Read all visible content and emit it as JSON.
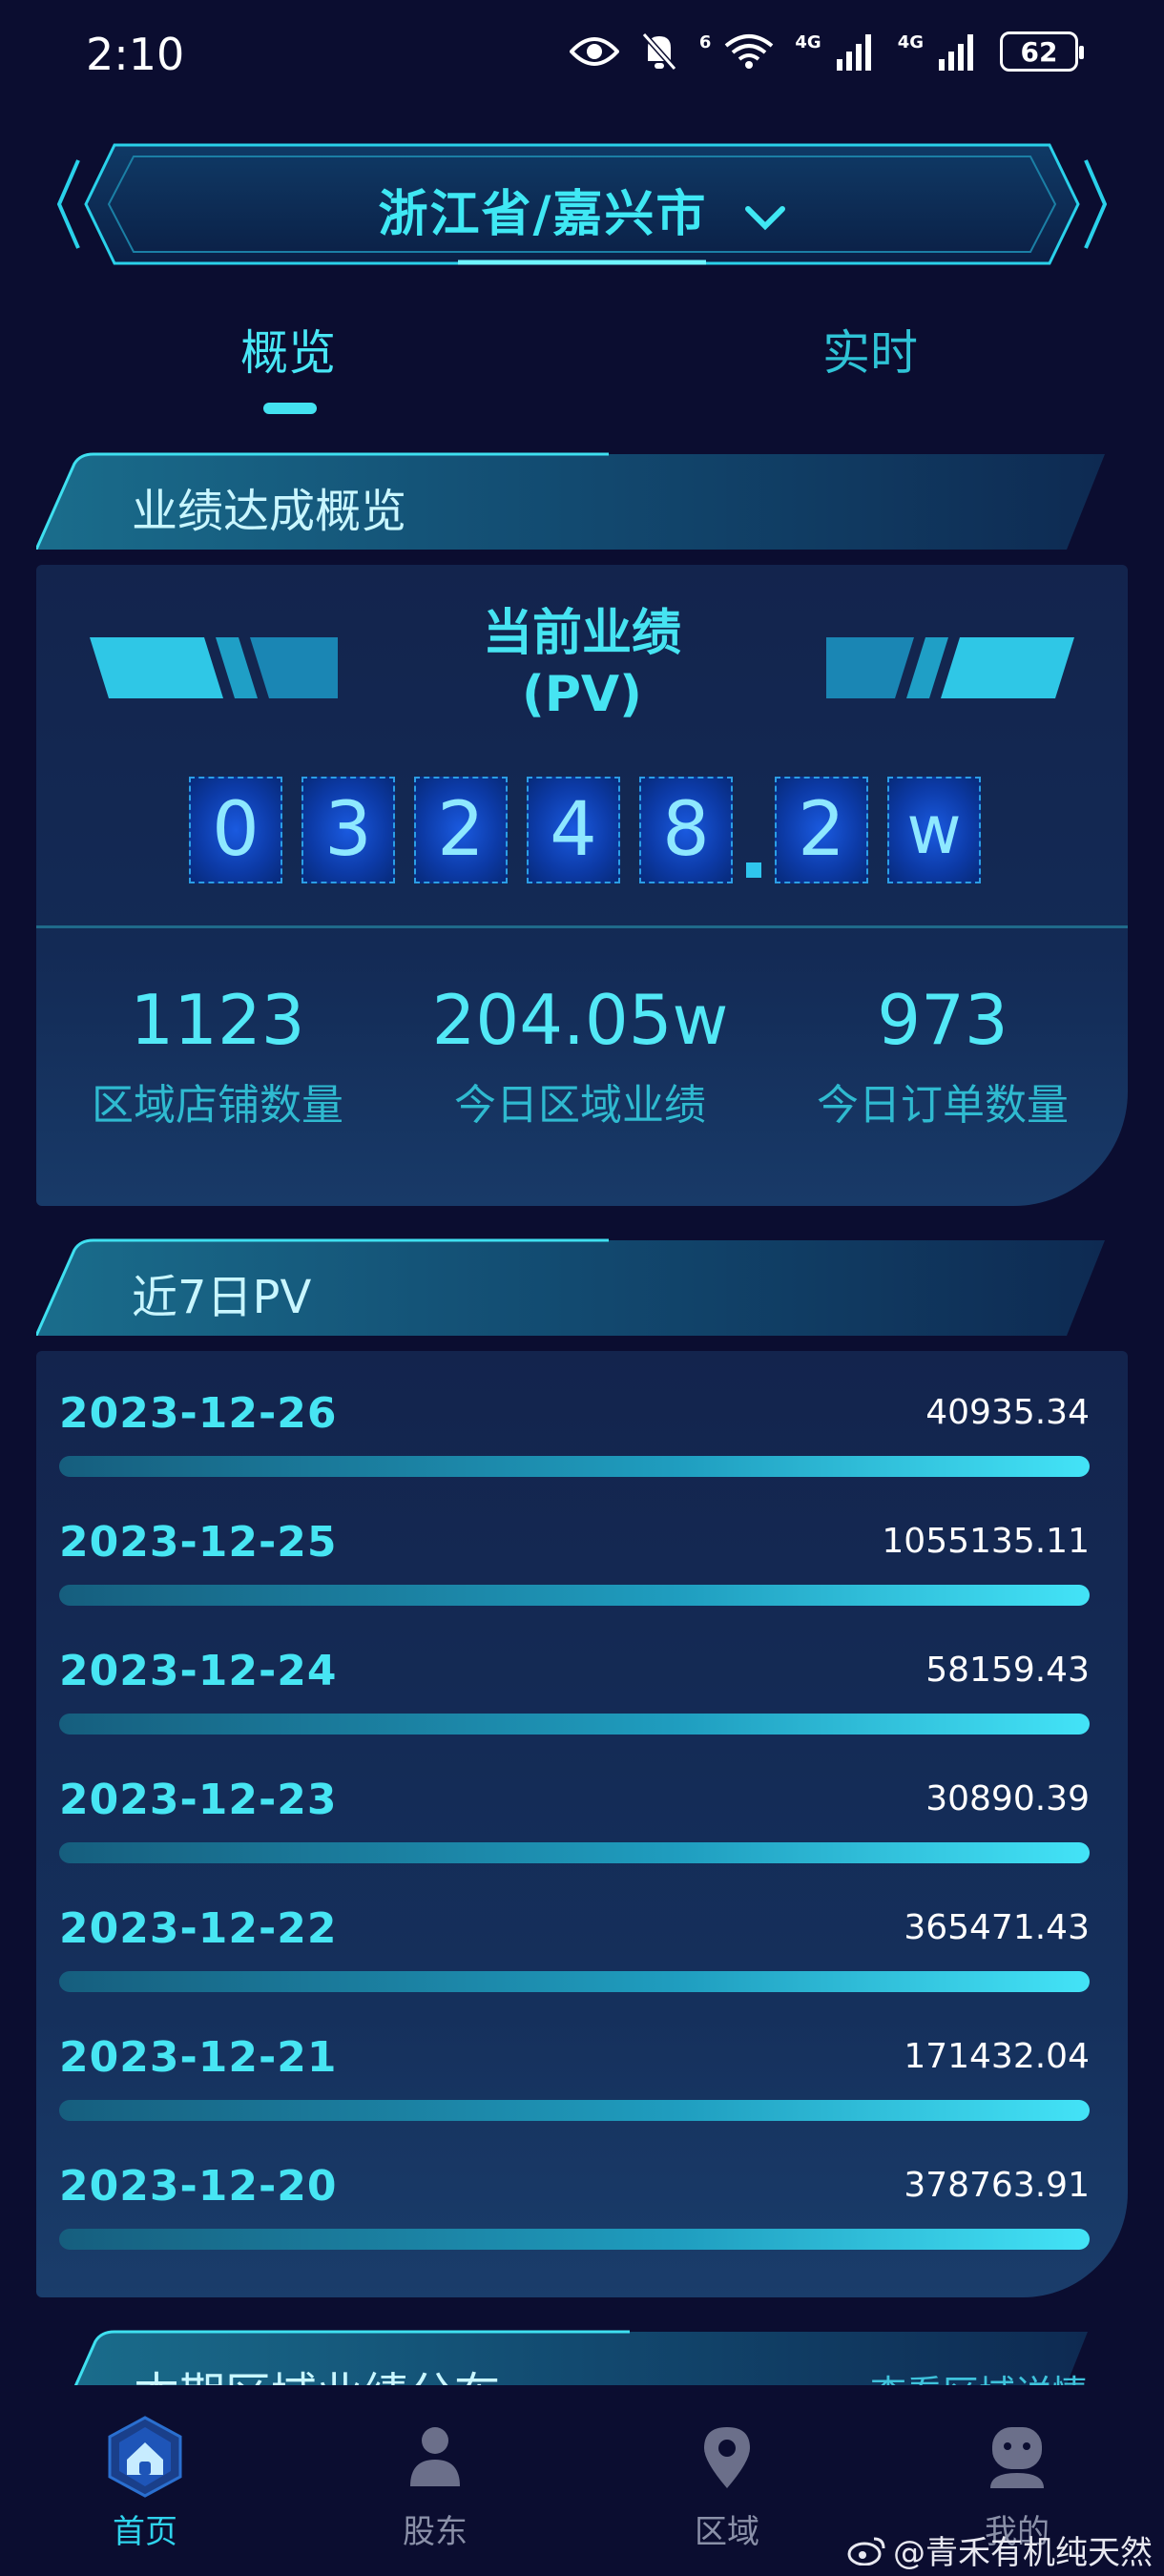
{
  "status_bar": {
    "time": "2:10",
    "wifi_label": "6",
    "sim1_label": "4G",
    "sim2_label": "4G",
    "battery": "62"
  },
  "region": {
    "label": "浙江省/嘉兴市"
  },
  "tabs": [
    {
      "label": "概览",
      "active": true
    },
    {
      "label": "实时",
      "active": false
    }
  ],
  "performance": {
    "section_title": "业绩达成概览",
    "card_title_line1": "当前业绩",
    "card_title_line2": "(PV)",
    "digits": [
      "0",
      "3",
      "2",
      "4",
      "8"
    ],
    "decimal_digit": "2",
    "unit": "w",
    "stats": [
      {
        "value": "1123",
        "label": "区域店铺数量"
      },
      {
        "value": "204.05w",
        "label": "今日区域业绩"
      },
      {
        "value": "973",
        "label": "今日订单数量"
      }
    ]
  },
  "pv7": {
    "section_title": "近7日PV",
    "rows": [
      {
        "date": "2023-12-26",
        "value": "40935.34"
      },
      {
        "date": "2023-12-25",
        "value": "1055135.11"
      },
      {
        "date": "2023-12-24",
        "value": "58159.43"
      },
      {
        "date": "2023-12-23",
        "value": "30890.39"
      },
      {
        "date": "2023-12-22",
        "value": "365471.43"
      },
      {
        "date": "2023-12-21",
        "value": "171432.04"
      },
      {
        "date": "2023-12-20",
        "value": "378763.91"
      }
    ]
  },
  "distribution": {
    "section_title": "本期区域业绩分布",
    "link": "查看区域详情"
  },
  "tab_bar": [
    {
      "label": "首页",
      "icon": "home-icon",
      "active": true
    },
    {
      "label": "股东",
      "icon": "person-icon",
      "active": false
    },
    {
      "label": "区域",
      "icon": "location-pin-icon",
      "active": false
    },
    {
      "label": "我的",
      "icon": "profile-icon",
      "active": false
    }
  ],
  "watermark": "@青禾有机纯天然",
  "colors": {
    "background": "#0b0d30",
    "accent": "#46e4f2",
    "card": "#13244d"
  }
}
